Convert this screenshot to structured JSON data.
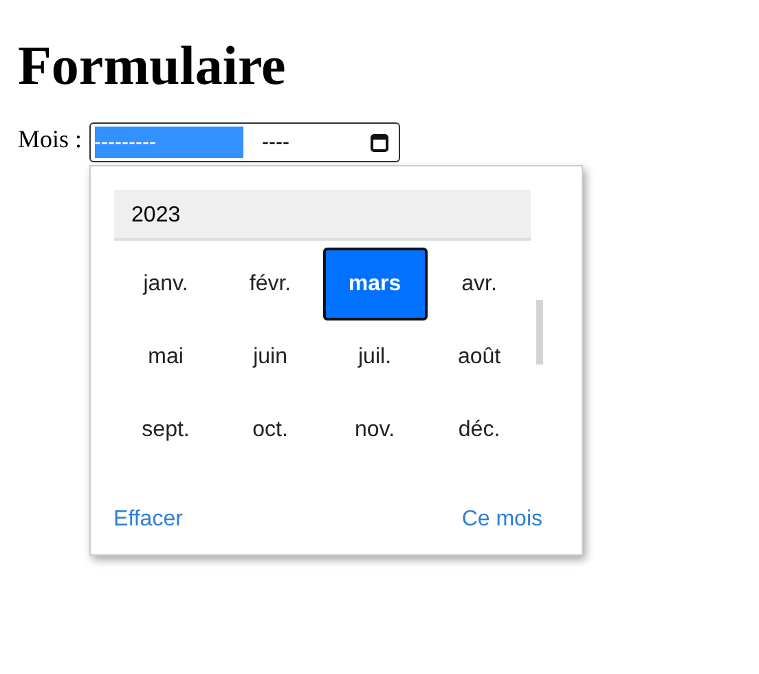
{
  "heading": "Formulaire",
  "field": {
    "label": "Mois :",
    "month_part": "---------",
    "year_part": "----",
    "month_part_selected": true
  },
  "picker": {
    "year": "2023",
    "months": [
      {
        "label": "janv.",
        "selected": false
      },
      {
        "label": "févr.",
        "selected": false
      },
      {
        "label": "mars",
        "selected": true
      },
      {
        "label": "avr.",
        "selected": false
      },
      {
        "label": "mai",
        "selected": false
      },
      {
        "label": "juin",
        "selected": false
      },
      {
        "label": "juil.",
        "selected": false
      },
      {
        "label": "août",
        "selected": false
      },
      {
        "label": "sept.",
        "selected": false
      },
      {
        "label": "oct.",
        "selected": false
      },
      {
        "label": "nov.",
        "selected": false
      },
      {
        "label": "déc.",
        "selected": false
      }
    ],
    "buttons": [
      "Effacer",
      "Ce mois"
    ]
  }
}
